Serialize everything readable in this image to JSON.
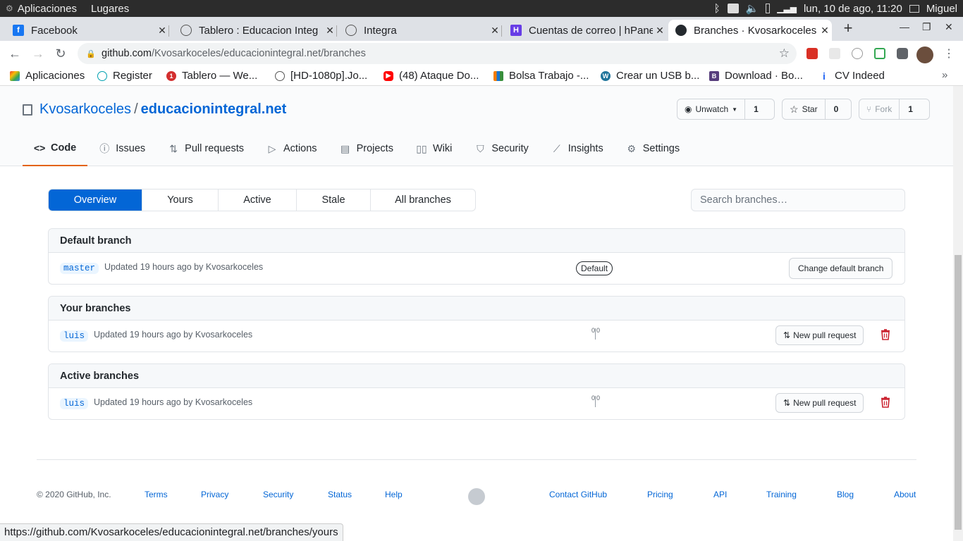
{
  "system": {
    "menu_apps": "Aplicaciones",
    "menu_places": "Lugares",
    "datetime": "lun, 10 de ago, 11:20",
    "user": "Miguel"
  },
  "tabs": [
    {
      "title": "Facebook",
      "favicon": "facebook-icon"
    },
    {
      "title": "Tablero : Educacion Integ",
      "favicon": "globe-icon"
    },
    {
      "title": "Integra",
      "favicon": "globe-icon"
    },
    {
      "title": "Cuentas de correo | hPane",
      "favicon": "hostinger-icon"
    },
    {
      "title": "Branches · Kvosarkoceles",
      "favicon": "github-icon"
    }
  ],
  "browser": {
    "url_host": "github.com",
    "url_path": "/Kvosarkoceles/educacionintegral.net/branches"
  },
  "bookmarks": [
    {
      "label": "Aplicaciones"
    },
    {
      "label": "Register"
    },
    {
      "label": "Tablero — We..."
    },
    {
      "label": "[HD-1080p].Jo..."
    },
    {
      "label": "(48) Ataque Do..."
    },
    {
      "label": "Bolsa Trabajo -..."
    },
    {
      "label": "Crear un USB b..."
    },
    {
      "label": "Download · Bo..."
    },
    {
      "label": "CV Indeed"
    }
  ],
  "repo": {
    "owner": "Kvosarkoceles",
    "separator": "/",
    "name": "educacionintegral.net",
    "watch_label": "Unwatch",
    "watch_count": "1",
    "star_label": "Star",
    "star_count": "0",
    "fork_label": "Fork",
    "fork_count": "1"
  },
  "repo_nav": [
    {
      "label": "Code",
      "icon": "code-icon"
    },
    {
      "label": "Issues",
      "icon": "issue-icon"
    },
    {
      "label": "Pull requests",
      "icon": "pull-request-icon"
    },
    {
      "label": "Actions",
      "icon": "play-icon"
    },
    {
      "label": "Projects",
      "icon": "project-icon"
    },
    {
      "label": "Wiki",
      "icon": "book-icon"
    },
    {
      "label": "Security",
      "icon": "shield-icon"
    },
    {
      "label": "Insights",
      "icon": "graph-icon"
    },
    {
      "label": "Settings",
      "icon": "gear-icon"
    }
  ],
  "branch_tabs": [
    "Overview",
    "Yours",
    "Active",
    "Stale",
    "All branches"
  ],
  "search_placeholder": "Search branches…",
  "default_section": {
    "title": "Default branch",
    "branch": "master",
    "updated": "Updated 19 hours ago by Kvosarkoceles",
    "badge": "Default",
    "action": "Change default branch"
  },
  "your_section": {
    "title": "Your branches",
    "branch": "luis",
    "updated": "Updated 19 hours ago by Kvosarkoceles",
    "behind": "0",
    "ahead": "0",
    "action": "New pull request"
  },
  "active_section": {
    "title": "Active branches",
    "branch": "luis",
    "updated": "Updated 19 hours ago by Kvosarkoceles",
    "behind": "0",
    "ahead": "0",
    "action": "New pull request"
  },
  "footer": {
    "copyright": "© 2020 GitHub, Inc.",
    "links_left": [
      "Terms",
      "Privacy",
      "Security",
      "Status",
      "Help"
    ],
    "links_right": [
      "Contact GitHub",
      "Pricing",
      "API",
      "Training",
      "Blog",
      "About"
    ]
  },
  "status_url": "https://github.com/Kvosarkoceles/educacionintegral.net/branches/yours",
  "colors": {
    "accent": "#0366d6",
    "selected_tab_border": "#e36209",
    "delete": "#cb2431"
  }
}
